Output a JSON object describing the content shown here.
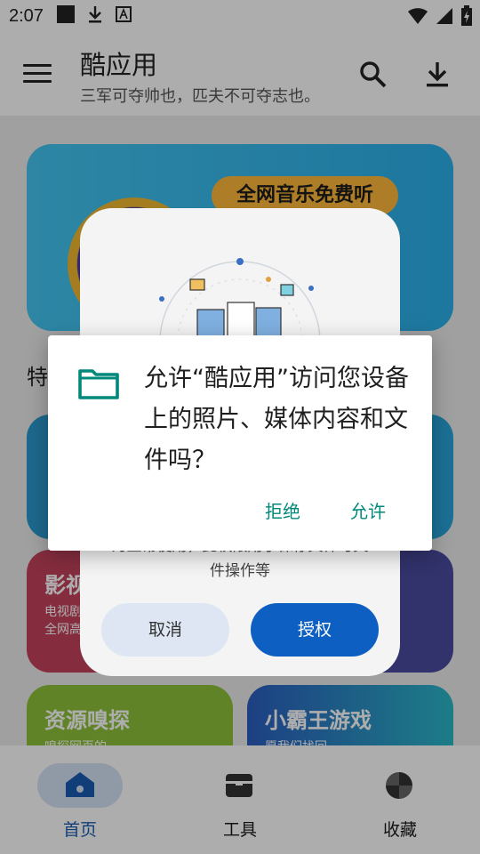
{
  "status_bar": {
    "time": "2:07"
  },
  "app_bar": {
    "title": "酷应用",
    "subtitle": "三军可夺帅也，匹夫不可夺志也。"
  },
  "banner": {
    "badge": "全网音乐免费听"
  },
  "section": {
    "label": "特"
  },
  "tiles": {
    "row1a": {
      "title": "",
      "sub": ""
    },
    "film": {
      "title": "影视",
      "sub_1": "电视剧",
      "sub_2": "全网高"
    },
    "resource": {
      "title": "资源嗅探",
      "sub": "嗅探网页的"
    },
    "game": {
      "title": "小霸王游戏",
      "sub": "愿我们找回"
    }
  },
  "permission_sheet": {
    "text_line_1": "为正常使用，此权限用于保存文件与文",
    "text_line_2": "件操作等",
    "cancel_label": "取消",
    "authorize_label": "授权"
  },
  "dialog": {
    "message": "允许“酷应用”访问您设备上的照片、媒体内容和文件吗？",
    "deny_label": "拒绝",
    "allow_label": "允许",
    "accent_color": "#00897b"
  },
  "bottom_nav": {
    "items": [
      {
        "label": "首页",
        "icon": "home-icon",
        "active": true
      },
      {
        "label": "工具",
        "icon": "toolbox-icon",
        "active": false
      },
      {
        "label": "收藏",
        "icon": "pinwheel-icon",
        "active": false
      }
    ]
  }
}
